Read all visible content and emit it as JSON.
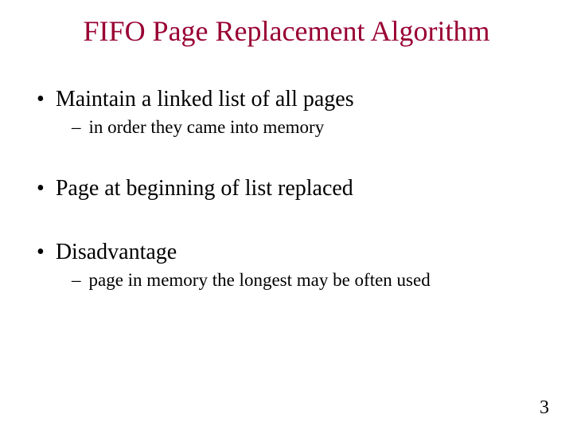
{
  "title": "FIFO Page Replacement Algorithm",
  "bullets": {
    "b1": "Maintain a linked list of all pages",
    "b1_sub1": "in order they came into memory",
    "b2": "Page at beginning of list replaced",
    "b3": "Disadvantage",
    "b3_sub1": "page in memory the longest may be often used"
  },
  "markers": {
    "dot": "•",
    "dash": "–"
  },
  "page_number": "3"
}
